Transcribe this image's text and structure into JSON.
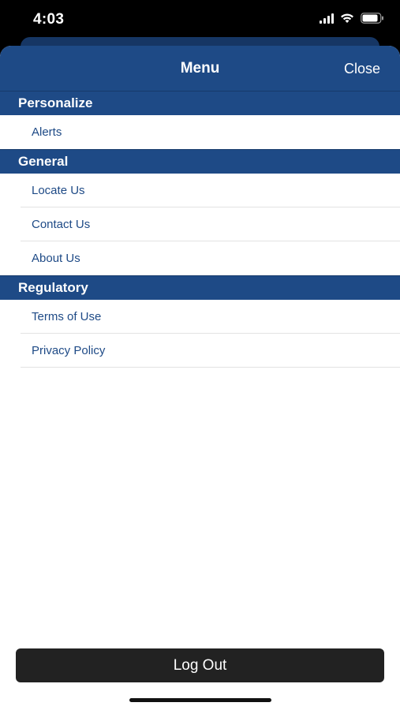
{
  "status_bar": {
    "time": "4:03",
    "icons": [
      "cellular-signal-icon",
      "wifi-icon",
      "battery-icon"
    ]
  },
  "nav": {
    "title": "Menu",
    "close_label": "Close"
  },
  "sections": {
    "personalize": {
      "title": "Personalize",
      "items": [
        "Alerts"
      ]
    },
    "general": {
      "title": "General",
      "items": [
        "Locate Us",
        "Contact Us",
        "About Us"
      ]
    },
    "regulatory": {
      "title": "Regulatory",
      "items": [
        "Terms of Use",
        "Privacy Policy"
      ]
    }
  },
  "footer": {
    "logout_label": "Log Out"
  },
  "colors": {
    "brand_blue": "#1e4a86",
    "link_blue": "#1e4a86",
    "button_dark": "#222222",
    "background": "#ffffff"
  }
}
